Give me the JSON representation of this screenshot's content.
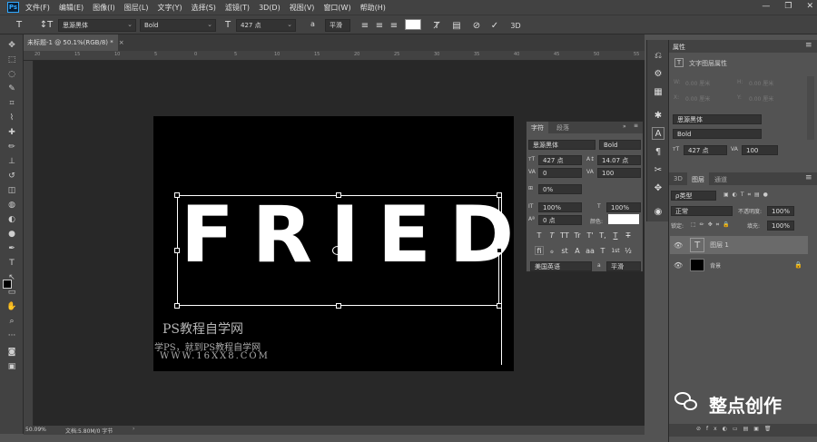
{
  "app": {
    "logo": "Ps"
  },
  "menu": [
    "文件(F)",
    "编辑(E)",
    "图像(I)",
    "图层(L)",
    "文字(Y)",
    "选择(S)",
    "滤镜(T)",
    "3D(D)",
    "视图(V)",
    "窗口(W)",
    "帮助(H)"
  ],
  "window_controls": {
    "minimize": "—",
    "maximize": "❐",
    "close": "✕"
  },
  "options": {
    "font_family": "思源黑体",
    "font_style": "Bold",
    "font_size": "427 点",
    "aa_label": "a",
    "antialias": "平滑",
    "threeD": "3D"
  },
  "document": {
    "tab_title": "未标题-1 @ 50.1%(RGB/8) *",
    "close": "×"
  },
  "ruler": {
    "ticks": [
      "20",
      "15",
      "10",
      "5",
      "0",
      "5",
      "10",
      "15",
      "20",
      "25",
      "30",
      "35",
      "40",
      "45",
      "50",
      "55"
    ]
  },
  "canvas": {
    "text": "FRIED",
    "watermark": {
      "line1": "PS教程自学网",
      "line2": "学PS，就到PS教程自学网",
      "line3": "WWW.16XX8.COM"
    }
  },
  "status": {
    "zoom": "50.09%",
    "doc": "文档:5.80M/0 字节"
  },
  "character_panel": {
    "tab1": "字符",
    "tab2": "段落",
    "font_family": "思源黑体",
    "font_style": "Bold",
    "size": "427 点",
    "leading": "14.07 点",
    "kerning": "0",
    "tracking": "100",
    "scale_pct": "0%",
    "vscale": "100%",
    "hscale": "100%",
    "baseline": "0 点",
    "color_label": "颜色:",
    "language": "美国英语",
    "aa_label": "a",
    "antialias": "平滑",
    "style_buttons": [
      "T",
      "T",
      "TT",
      "Tr",
      "T'",
      "T,",
      "T",
      "T"
    ],
    "ot_buttons": [
      "fi",
      "ℴ",
      "st",
      "A",
      "aa",
      "T",
      "1st",
      "½"
    ]
  },
  "properties_panel": {
    "title": "属性",
    "subtitle": "文字图层属性",
    "w_label": "W:",
    "w_value": "0.00 厘米",
    "h_label": "H:",
    "h_value": "0.00 厘米",
    "x_label": "X:",
    "x_value": "0.00 厘米",
    "y_label": "Y:",
    "y_value": "0.00 厘米",
    "font_family": "思源黑体",
    "font_style": "Bold",
    "size": "427 点",
    "tracking": "100"
  },
  "layers_panel": {
    "tabs": [
      "3D",
      "图层",
      "通道"
    ],
    "filter_type": "ρ类型",
    "blend_mode": "正常",
    "opacity_label": "不透明度:",
    "opacity": "100%",
    "lock_label": "锁定:",
    "fill_label": "填充:",
    "fill": "100%",
    "layers": [
      {
        "name": "图层 1",
        "thumb": "T"
      },
      {
        "name": "背景",
        "thumb": ""
      }
    ]
  },
  "wechat_badge": "整点创作",
  "colors": {
    "ui_bg": "#535353",
    "bar_bg": "#424242",
    "workspace": "#282828",
    "accent": "#31a8ff"
  }
}
